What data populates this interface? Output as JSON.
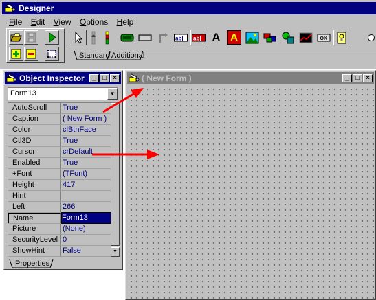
{
  "main_window": {
    "title": "Designer",
    "menu": [
      {
        "label": "File",
        "key": "F"
      },
      {
        "label": "Edit",
        "key": "E"
      },
      {
        "label": "View",
        "key": "V"
      },
      {
        "label": "Options",
        "key": "O"
      },
      {
        "label": "Help",
        "key": "H"
      }
    ],
    "speedbar_buttons": [
      "open-folder-icon",
      "save-disk-icon",
      "run-icon",
      "add-icon",
      "remove-icon",
      "form-select-icon"
    ],
    "palette_tabs": [
      "Standard",
      "Additional"
    ],
    "palette_components": [
      "pointer-icon",
      "scrollbar-icon",
      "stacked-bars-icon",
      "panel-icon",
      "keyboard-icon",
      "arrow-corner-icon",
      "edit-box-icon",
      "memo-icon",
      "label-icon",
      "static-text-icon",
      "image-icon",
      "flags-icon",
      "shape-icon",
      "chart-icon",
      "button-icon",
      "bulb-icon"
    ],
    "label_glyph": "A"
  },
  "object_inspector": {
    "title": "Object Inspector",
    "selected_object": "Form13",
    "properties": [
      {
        "name": "AutoScroll",
        "value": "True"
      },
      {
        "name": "Caption",
        "value": "( New Form )"
      },
      {
        "name": "Color",
        "value": "clBtnFace"
      },
      {
        "name": "Ctl3D",
        "value": "True"
      },
      {
        "name": "Cursor",
        "value": "crDefault"
      },
      {
        "name": "Enabled",
        "value": "True"
      },
      {
        "name": "+Font",
        "value": "(TFont)"
      },
      {
        "name": "Height",
        "value": "417"
      },
      {
        "name": "Hint",
        "value": ""
      },
      {
        "name": "Left",
        "value": "266"
      },
      {
        "name": "Name",
        "value": "Form13",
        "selected": true
      },
      {
        "name": "Picture",
        "value": "(None)"
      },
      {
        "name": "SecurityLevel",
        "value": "0"
      },
      {
        "name": "ShowHint",
        "value": "False"
      }
    ],
    "tab": "Properties"
  },
  "form_window": {
    "title": "( New Form )"
  },
  "colors": {
    "title_active": "#000080",
    "title_inactive": "#808080",
    "face": "#c0c0c0",
    "arrow": "#ff0000",
    "value_text": "#000080"
  }
}
